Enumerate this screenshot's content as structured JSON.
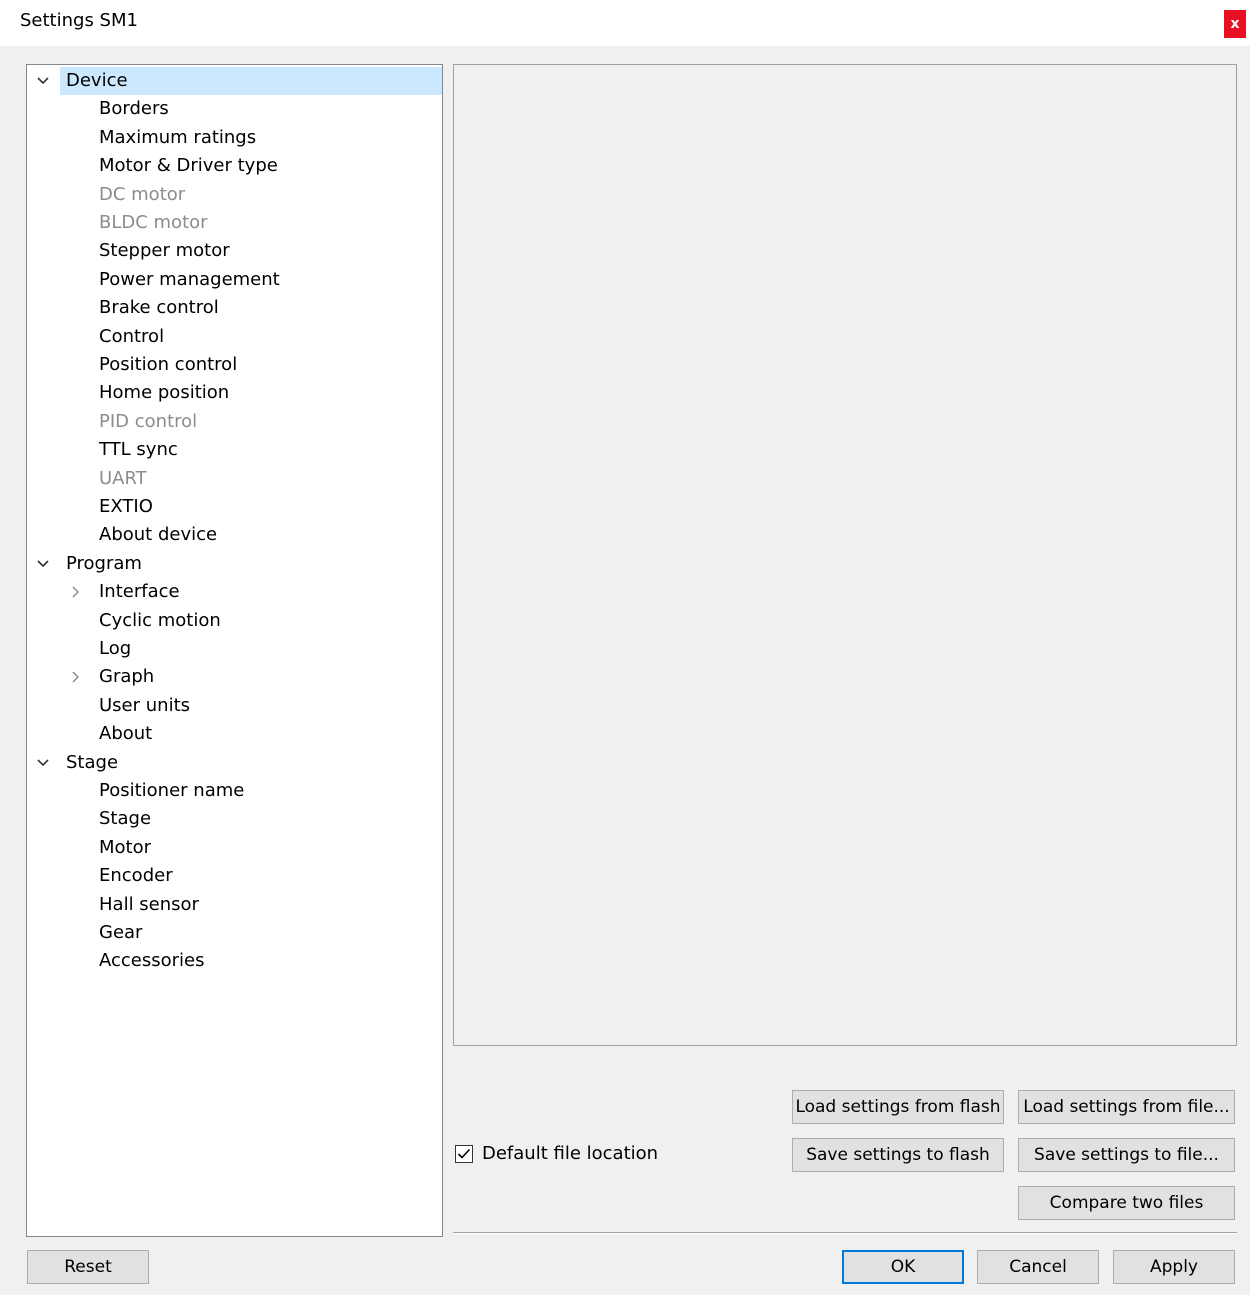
{
  "window": {
    "title": "Settings SM1",
    "close_label": "x"
  },
  "tree": {
    "items": [
      {
        "label": "Device",
        "level": 0,
        "expander": "expanded",
        "selected": true,
        "disabled": false
      },
      {
        "label": "Borders",
        "level": 1,
        "expander": "none",
        "selected": false,
        "disabled": false
      },
      {
        "label": "Maximum ratings",
        "level": 1,
        "expander": "none",
        "selected": false,
        "disabled": false
      },
      {
        "label": "Motor & Driver type",
        "level": 1,
        "expander": "none",
        "selected": false,
        "disabled": false
      },
      {
        "label": "DC motor",
        "level": 1,
        "expander": "none",
        "selected": false,
        "disabled": true
      },
      {
        "label": "BLDC motor",
        "level": 1,
        "expander": "none",
        "selected": false,
        "disabled": true
      },
      {
        "label": "Stepper motor",
        "level": 1,
        "expander": "none",
        "selected": false,
        "disabled": false
      },
      {
        "label": "Power management",
        "level": 1,
        "expander": "none",
        "selected": false,
        "disabled": false
      },
      {
        "label": "Brake control",
        "level": 1,
        "expander": "none",
        "selected": false,
        "disabled": false
      },
      {
        "label": "Control",
        "level": 1,
        "expander": "none",
        "selected": false,
        "disabled": false
      },
      {
        "label": "Position control",
        "level": 1,
        "expander": "none",
        "selected": false,
        "disabled": false
      },
      {
        "label": "Home position",
        "level": 1,
        "expander": "none",
        "selected": false,
        "disabled": false
      },
      {
        "label": "PID control",
        "level": 1,
        "expander": "none",
        "selected": false,
        "disabled": true
      },
      {
        "label": "TTL sync",
        "level": 1,
        "expander": "none",
        "selected": false,
        "disabled": false
      },
      {
        "label": "UART",
        "level": 1,
        "expander": "none",
        "selected": false,
        "disabled": true
      },
      {
        "label": "EXTIO",
        "level": 1,
        "expander": "none",
        "selected": false,
        "disabled": false
      },
      {
        "label": "About device",
        "level": 1,
        "expander": "none",
        "selected": false,
        "disabled": false
      },
      {
        "label": "Program",
        "level": 0,
        "expander": "expanded",
        "selected": false,
        "disabled": false
      },
      {
        "label": "Interface",
        "level": 1,
        "expander": "collapsed",
        "selected": false,
        "disabled": false
      },
      {
        "label": "Cyclic motion",
        "level": 1,
        "expander": "none",
        "selected": false,
        "disabled": false
      },
      {
        "label": "Log",
        "level": 1,
        "expander": "none",
        "selected": false,
        "disabled": false
      },
      {
        "label": "Graph",
        "level": 1,
        "expander": "collapsed",
        "selected": false,
        "disabled": false
      },
      {
        "label": "User units",
        "level": 1,
        "expander": "none",
        "selected": false,
        "disabled": false
      },
      {
        "label": "About",
        "level": 1,
        "expander": "none",
        "selected": false,
        "disabled": false
      },
      {
        "label": "Stage",
        "level": 0,
        "expander": "expanded",
        "selected": false,
        "disabled": false
      },
      {
        "label": "Positioner name",
        "level": 1,
        "expander": "none",
        "selected": false,
        "disabled": false
      },
      {
        "label": "Stage",
        "level": 1,
        "expander": "none",
        "selected": false,
        "disabled": false
      },
      {
        "label": "Motor",
        "level": 1,
        "expander": "none",
        "selected": false,
        "disabled": false
      },
      {
        "label": "Encoder",
        "level": 1,
        "expander": "none",
        "selected": false,
        "disabled": false
      },
      {
        "label": "Hall sensor",
        "level": 1,
        "expander": "none",
        "selected": false,
        "disabled": false
      },
      {
        "label": "Gear",
        "level": 1,
        "expander": "none",
        "selected": false,
        "disabled": false
      },
      {
        "label": "Accessories",
        "level": 1,
        "expander": "none",
        "selected": false,
        "disabled": false
      }
    ]
  },
  "file_actions": {
    "load_flash": "Load settings from flash",
    "load_file": "Load settings from file...",
    "save_flash": "Save settings to flash",
    "save_file": "Save settings to file...",
    "compare": "Compare two files"
  },
  "default_location": {
    "label": "Default file location",
    "checked": true
  },
  "footer": {
    "reset": "Reset",
    "ok": "OK",
    "cancel": "Cancel",
    "apply": "Apply"
  },
  "colors": {
    "selection": "#cce8ff",
    "disabled_text": "#8c8c8c",
    "close_button": "#e81123",
    "default_button_border": "#0078d7"
  }
}
